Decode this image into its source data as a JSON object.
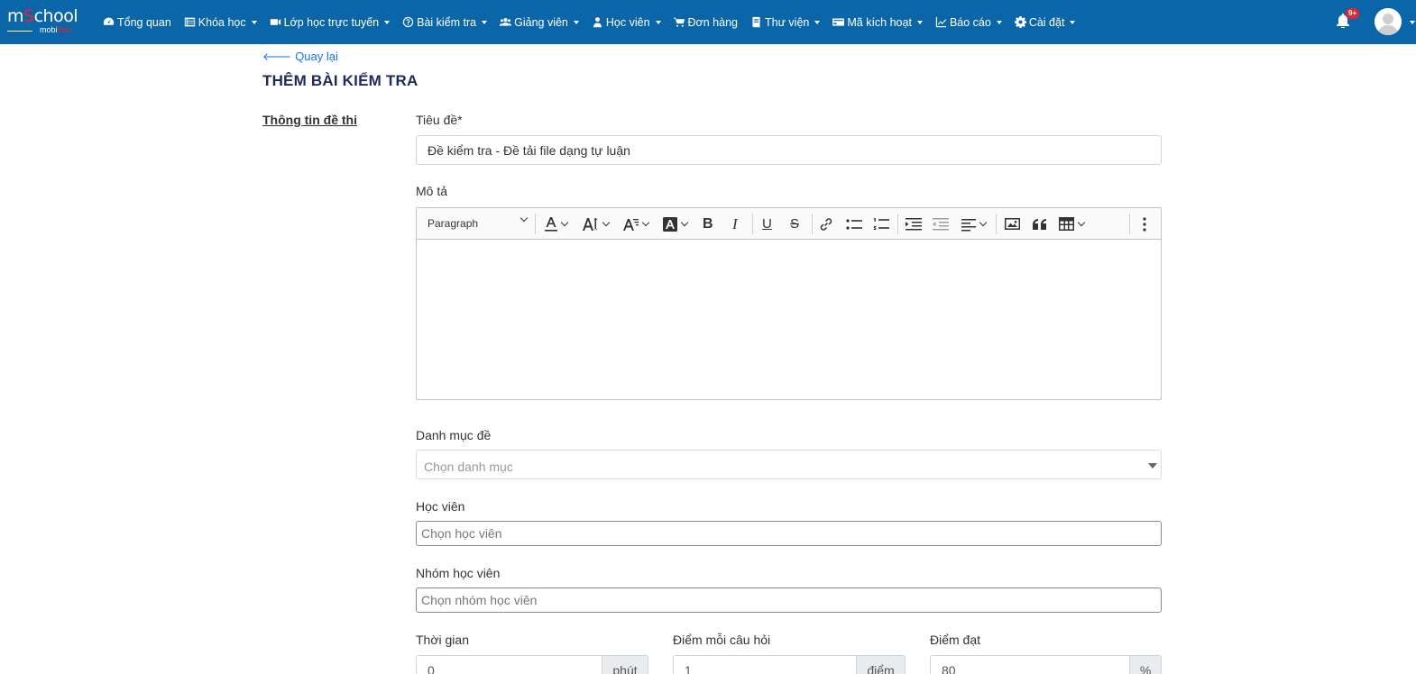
{
  "brand": {
    "logo_m": "m",
    "logo_s": "S",
    "logo_chool": "chool",
    "logo_sub_a": "mobi",
    "logo_sub_b": "Edu"
  },
  "nav": {
    "items": [
      {
        "label": "Tổng quan",
        "icon": "dashboard-icon",
        "caret": false
      },
      {
        "label": "Khóa học",
        "icon": "list-icon",
        "caret": true
      },
      {
        "label": "Lớp học trực tuyến",
        "icon": "video-icon",
        "caret": true
      },
      {
        "label": "Bài kiểm tra",
        "icon": "question-icon",
        "caret": true
      },
      {
        "label": "Giảng viên",
        "icon": "users-icon",
        "caret": true
      },
      {
        "label": "Học viên",
        "icon": "user-icon",
        "caret": true
      },
      {
        "label": "Đơn hàng",
        "icon": "cart-icon",
        "caret": false
      },
      {
        "label": "Thư viện",
        "icon": "book-icon",
        "caret": true
      },
      {
        "label": "Mã kích hoạt",
        "icon": "card-icon",
        "caret": true
      },
      {
        "label": "Báo cáo",
        "icon": "chart-icon",
        "caret": true
      },
      {
        "label": "Cài đặt",
        "icon": "gear-icon",
        "caret": true
      }
    ],
    "notification_badge": "9+"
  },
  "page": {
    "back_label": "Quay lại",
    "title": "THÊM BÀI KIỂM TRA",
    "section_label": "Thông tin đề thi"
  },
  "form": {
    "title_label": "Tiêu đề*",
    "title_value": "Đề kiểm tra - Đề tải file dạng tự luận",
    "description_label": "Mô tả",
    "editor_paragraph": "Paragraph",
    "category_label": "Danh mục đề",
    "category_placeholder": "Chọn danh mục",
    "student_label": "Học viên",
    "student_placeholder": "Chọn học viên",
    "student_group_label": "Nhóm học viên",
    "student_group_placeholder": "Chọn nhóm học viên",
    "time_label": "Thời gian",
    "time_value": "0",
    "time_unit": "phút",
    "points_label": "Điểm mỗi câu hỏi",
    "points_value": "1",
    "points_unit": "điểm",
    "pass_label": "Điểm đạt",
    "pass_value": "80",
    "pass_unit": "%"
  },
  "colors": {
    "topbar": "#0a66a8",
    "accent_link": "#1a73e8",
    "title": "#1f2a5c",
    "badge": "#e4252b"
  }
}
